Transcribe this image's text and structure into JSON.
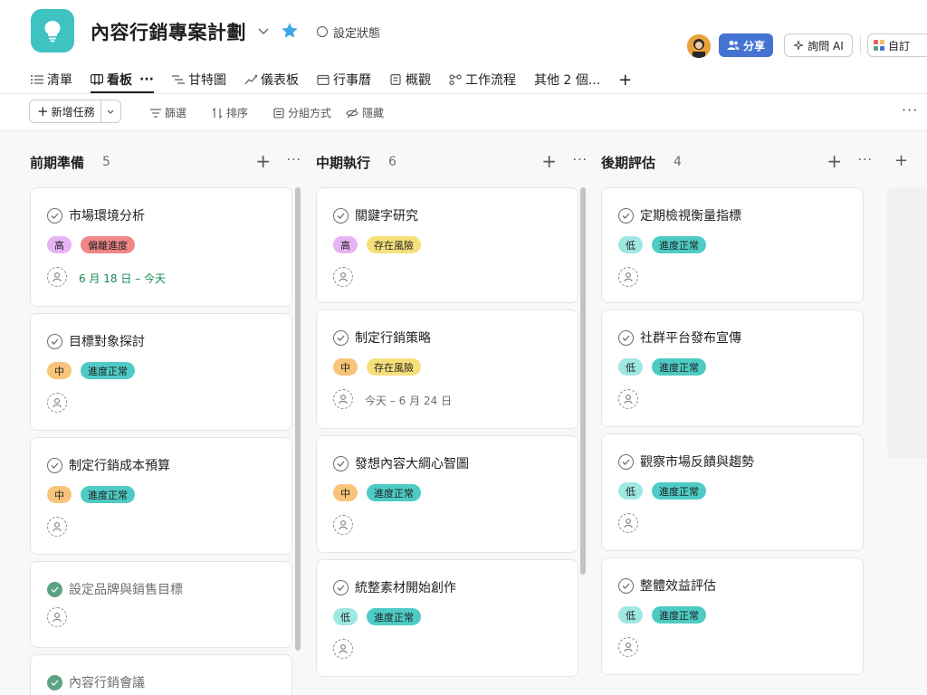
{
  "project": {
    "title": "內容行銷專案計劃",
    "status": "設定狀態",
    "icon": "lightbulb-icon",
    "icon_color": "#3ec2c2"
  },
  "header_actions": {
    "share": "分享",
    "ask_ai": "詢問 AI",
    "customize": "自訂"
  },
  "tabs": [
    {
      "label": "清單",
      "icon": "list-icon"
    },
    {
      "label": "看板",
      "icon": "board-icon",
      "active": true
    },
    {
      "label": "甘特圖",
      "icon": "gantt-icon"
    },
    {
      "label": "儀表板",
      "icon": "dashboard-icon"
    },
    {
      "label": "行事曆",
      "icon": "calendar-icon"
    },
    {
      "label": "概觀",
      "icon": "overview-icon"
    },
    {
      "label": "工作流程",
      "icon": "workflow-icon"
    },
    {
      "label": "其他 2 個...",
      "icon": ""
    }
  ],
  "toolbar": {
    "add_task": "新增任務",
    "filter": "篩選",
    "sort": "排序",
    "group": "分組方式",
    "hide": "隱藏"
  },
  "colors": {
    "priority_high": "#e8b3f4",
    "priority_mid": "#f8c47a",
    "priority_low": "#9ee7e3",
    "status_off_track": "#f08686",
    "status_at_risk": "#f7e07a",
    "status_on_track": "#4ecbc4",
    "due_green": "#138a55",
    "share_blue": "#4573d2"
  },
  "columns": [
    {
      "title": "前期準備",
      "count": "5",
      "cards": [
        {
          "title": "市場環境分析",
          "priority": "高",
          "status": "偏離進度",
          "due": "6 月 18 日 – 今天",
          "due_color": "green",
          "done": false
        },
        {
          "title": "目標對象探討",
          "priority": "中",
          "status": "進度正常",
          "due": "",
          "done": false
        },
        {
          "title": "制定行銷成本預算",
          "priority": "中",
          "status": "進度正常",
          "due": "",
          "done": false
        },
        {
          "title": "設定品牌與銷售目標",
          "priority": "",
          "status": "",
          "due": "",
          "done": true
        },
        {
          "title": "內容行銷會議",
          "priority": "",
          "status": "",
          "due": "",
          "done": true
        }
      ]
    },
    {
      "title": "中期執行",
      "count": "6",
      "cards": [
        {
          "title": "關鍵字研究",
          "priority": "高",
          "status": "存在風險",
          "due": "",
          "done": false
        },
        {
          "title": "制定行銷策略",
          "priority": "中",
          "status": "存在風險",
          "due": "今天 – 6 月 24 日",
          "due_color": "gray",
          "done": false
        },
        {
          "title": "發想內容大綱心智圖",
          "priority": "中",
          "status": "進度正常",
          "due": "",
          "done": false
        },
        {
          "title": "統整素材開始創作",
          "priority": "低",
          "status": "進度正常",
          "due": "",
          "done": false
        }
      ]
    },
    {
      "title": "後期評估",
      "count": "4",
      "cards": [
        {
          "title": "定期檢視衡量指標",
          "priority": "低",
          "status": "進度正常",
          "due": "",
          "done": false
        },
        {
          "title": "社群平台發布宣傳",
          "priority": "低",
          "status": "進度正常",
          "due": "",
          "done": false
        },
        {
          "title": "觀察市場反饋與趨勢",
          "priority": "低",
          "status": "進度正常",
          "due": "",
          "done": false
        },
        {
          "title": "整體效益評估",
          "priority": "低",
          "status": "進度正常",
          "due": "",
          "done": false
        }
      ]
    }
  ]
}
